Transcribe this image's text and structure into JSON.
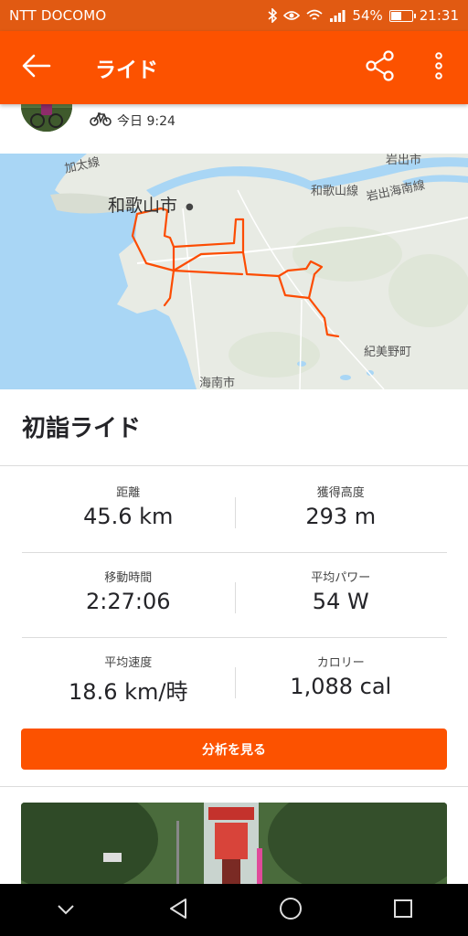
{
  "status_bar": {
    "carrier": "NTT DOCOMO",
    "battery": "54%",
    "battery_level": 0.54,
    "time": "21:31",
    "icons": [
      "bluetooth-icon",
      "eye-icon",
      "wifi-icon",
      "signal-icon",
      "battery-icon"
    ]
  },
  "app_bar": {
    "title": "ライド",
    "icons": [
      "back-arrow-icon",
      "share-icon",
      "more-vert-icon"
    ]
  },
  "activity": {
    "date": "今日 9:24",
    "type_icon": "bike-icon",
    "title": "初詣ライド"
  },
  "map": {
    "labels": {
      "wakayama_city": "和歌山市",
      "wakayama_line": "和歌山線",
      "kada_line": "加太線",
      "iwade_line": "岩出海南線",
      "iwade_city": "岩出市",
      "kimino": "紀美野町",
      "kainan": "海南市"
    },
    "route_color": "#fc4c02",
    "water_color": "#a9d6f5"
  },
  "stats": [
    [
      {
        "label": "距離",
        "value": "45.6 km"
      },
      {
        "label": "獲得高度",
        "value": "293 m"
      }
    ],
    [
      {
        "label": "移動時間",
        "value": "2:27:06"
      },
      {
        "label": "平均パワー",
        "value": "54 W"
      }
    ],
    [
      {
        "label": "平均速度",
        "value": "18.6 km/時"
      },
      {
        "label": "カロリー",
        "value": "1,088 cal"
      }
    ]
  ],
  "analyze_button": "分析を見る",
  "colors": {
    "accent": "#fc5200",
    "status_bar": "#e15a12"
  },
  "nav_bar": {
    "icons": [
      "chevron-down-icon",
      "back-triangle-icon",
      "home-circle-icon",
      "recents-square-icon"
    ]
  }
}
